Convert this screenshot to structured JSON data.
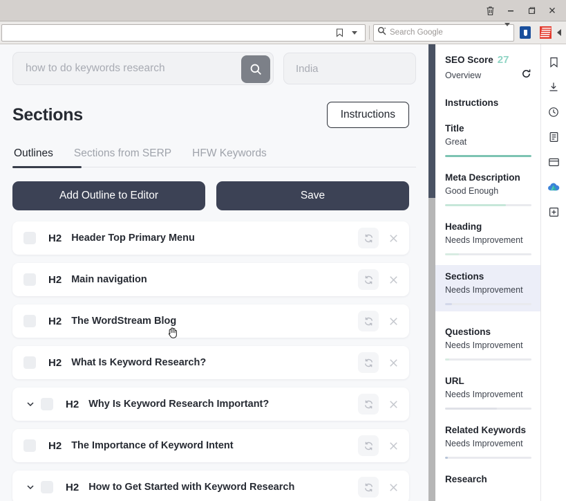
{
  "window": {
    "controls": [
      {
        "name": "trash-icon",
        "label": "Delete"
      },
      {
        "name": "minimize-button",
        "label": "Minimize"
      },
      {
        "name": "maximize-button",
        "label": "Maximize"
      },
      {
        "name": "close-button",
        "label": "Close"
      }
    ]
  },
  "browser": {
    "url_value": "",
    "url_placeholder": "",
    "bookmark_icon": "bookmark-icon",
    "search": {
      "placeholder": "Search Google",
      "value": "",
      "engine_icon": "google-search-icon"
    },
    "extensions": [
      {
        "name": "extension-blue-shield",
        "title": ""
      },
      {
        "name": "extension-red",
        "title": ""
      }
    ],
    "overflow_icon": "chevron-left-icon"
  },
  "main": {
    "keyword_input": {
      "value": "",
      "placeholder": "how to do keywords research",
      "search_icon": "search-icon"
    },
    "location_input": {
      "value": "",
      "placeholder": "India"
    },
    "page_title": "Sections",
    "instructions_button": "Instructions",
    "tabs": [
      {
        "label": "Outlines",
        "active": true
      },
      {
        "label": "Sections from SERP",
        "active": false
      },
      {
        "label": "HFW Keywords",
        "active": false
      }
    ],
    "actions": {
      "add_outline": "Add Outline to Editor",
      "save": "Save"
    },
    "rows": [
      {
        "tag": "H2",
        "text": "Header Top Primary Menu",
        "expandable": false
      },
      {
        "tag": "H2",
        "text": "Main navigation",
        "expandable": false
      },
      {
        "tag": "H2",
        "text": "The WordStream Blog",
        "expandable": false
      },
      {
        "tag": "H2",
        "text": "What Is Keyword Research?",
        "expandable": false
      },
      {
        "tag": "H2",
        "text": "Why Is Keyword Research Important?",
        "expandable": true
      },
      {
        "tag": "H2",
        "text": "The Importance of Keyword Intent",
        "expandable": false
      },
      {
        "tag": "H2",
        "text": "How to Get Started with Keyword Research",
        "expandable": true
      }
    ],
    "row_icons": {
      "refresh": "refresh-icon",
      "remove": "close-x-icon"
    }
  },
  "seo": {
    "header_label": "SEO Score",
    "score": "27",
    "score_color": "#8fd4c4",
    "overview_label": "Overview",
    "refresh_icon": "refresh-icon",
    "instructions_heading": "Instructions",
    "metrics": [
      {
        "name": "Title",
        "status": "Great",
        "progress": 100,
        "color": "#7cc3b2",
        "active": false
      },
      {
        "name": "Meta Description",
        "status": "Good Enough",
        "progress": 70,
        "color": "#c6e7d9",
        "active": false
      },
      {
        "name": "Heading",
        "status": "Needs Improvement",
        "progress": 16,
        "color": "#d8ece2",
        "active": false
      },
      {
        "name": "Sections",
        "status": "Needs Improvement",
        "progress": 8,
        "color": "#d3d8ea",
        "active": true
      },
      {
        "name": "Questions",
        "status": "Needs Improvement",
        "progress": 5,
        "color": "#d8ece2",
        "active": false
      },
      {
        "name": "URL",
        "status": "Needs Improvement",
        "progress": 60,
        "color": "#dfe1e7",
        "active": false
      },
      {
        "name": "Related Keywords",
        "status": "Needs Improvement",
        "progress": 3,
        "color": "#b7c4d8",
        "active": false
      },
      {
        "name": "Research",
        "status": "",
        "progress": 0,
        "color": "#d8ece2",
        "active": false
      }
    ]
  },
  "rail": {
    "icons": [
      {
        "name": "bookmark-icon"
      },
      {
        "name": "download-icon"
      },
      {
        "name": "history-clock-icon"
      },
      {
        "name": "reading-list-icon"
      },
      {
        "name": "wallet-icon"
      },
      {
        "name": "cloud-sync-icon"
      },
      {
        "name": "add-panel-icon"
      }
    ]
  }
}
